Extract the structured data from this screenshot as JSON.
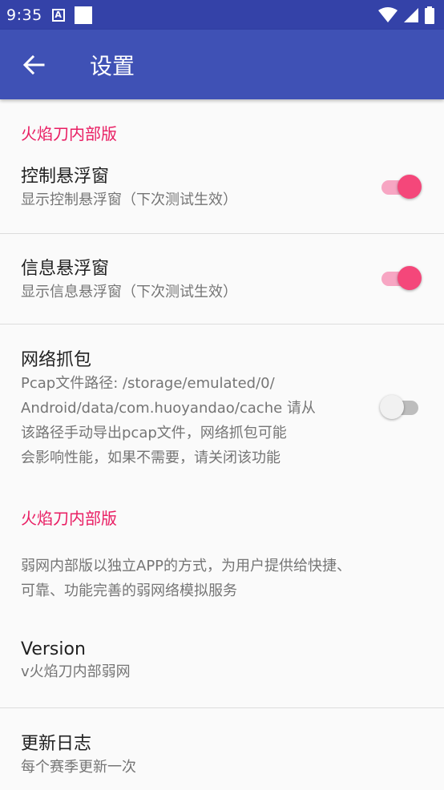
{
  "status_bar": {
    "time": "9:35",
    "notif_a": "A"
  },
  "app_bar": {
    "title": "设置"
  },
  "sections": {
    "cat1": "火焰刀内部版",
    "cat2": "火焰刀内部版"
  },
  "prefs": {
    "control_float": {
      "title": "控制悬浮窗",
      "summary": "显示控制悬浮窗（下次测试生效）",
      "checked": true
    },
    "info_float": {
      "title": "信息悬浮窗",
      "summary": "显示信息悬浮窗（下次测试生效）",
      "checked": true
    },
    "capture": {
      "title": "网络抓包",
      "summary_lines": [
        "Pcap文件路径: /storage/emulated/0/",
        "Android/data/com.huoyandao/cache 请从",
        "该路径手动导出pcap文件，网络抓包可能",
        "会影响性能，如果不需要，请关闭该功能"
      ],
      "checked": false
    },
    "about": {
      "summary_lines": [
        "弱网内部版以独立APP的方式，为用户提供给快捷、",
        "可靠、功能完善的弱网络模拟服务"
      ]
    },
    "version": {
      "title": "Version",
      "summary": "v火焰刀内部弱网"
    },
    "changelog": {
      "title": "更新日志",
      "summary": "每个赛季更新一次"
    }
  },
  "colors": {
    "statusbar": "#3442a8",
    "appbar": "#3f51b5",
    "accent": "#e91e63",
    "switch_on": "#f4477a"
  }
}
